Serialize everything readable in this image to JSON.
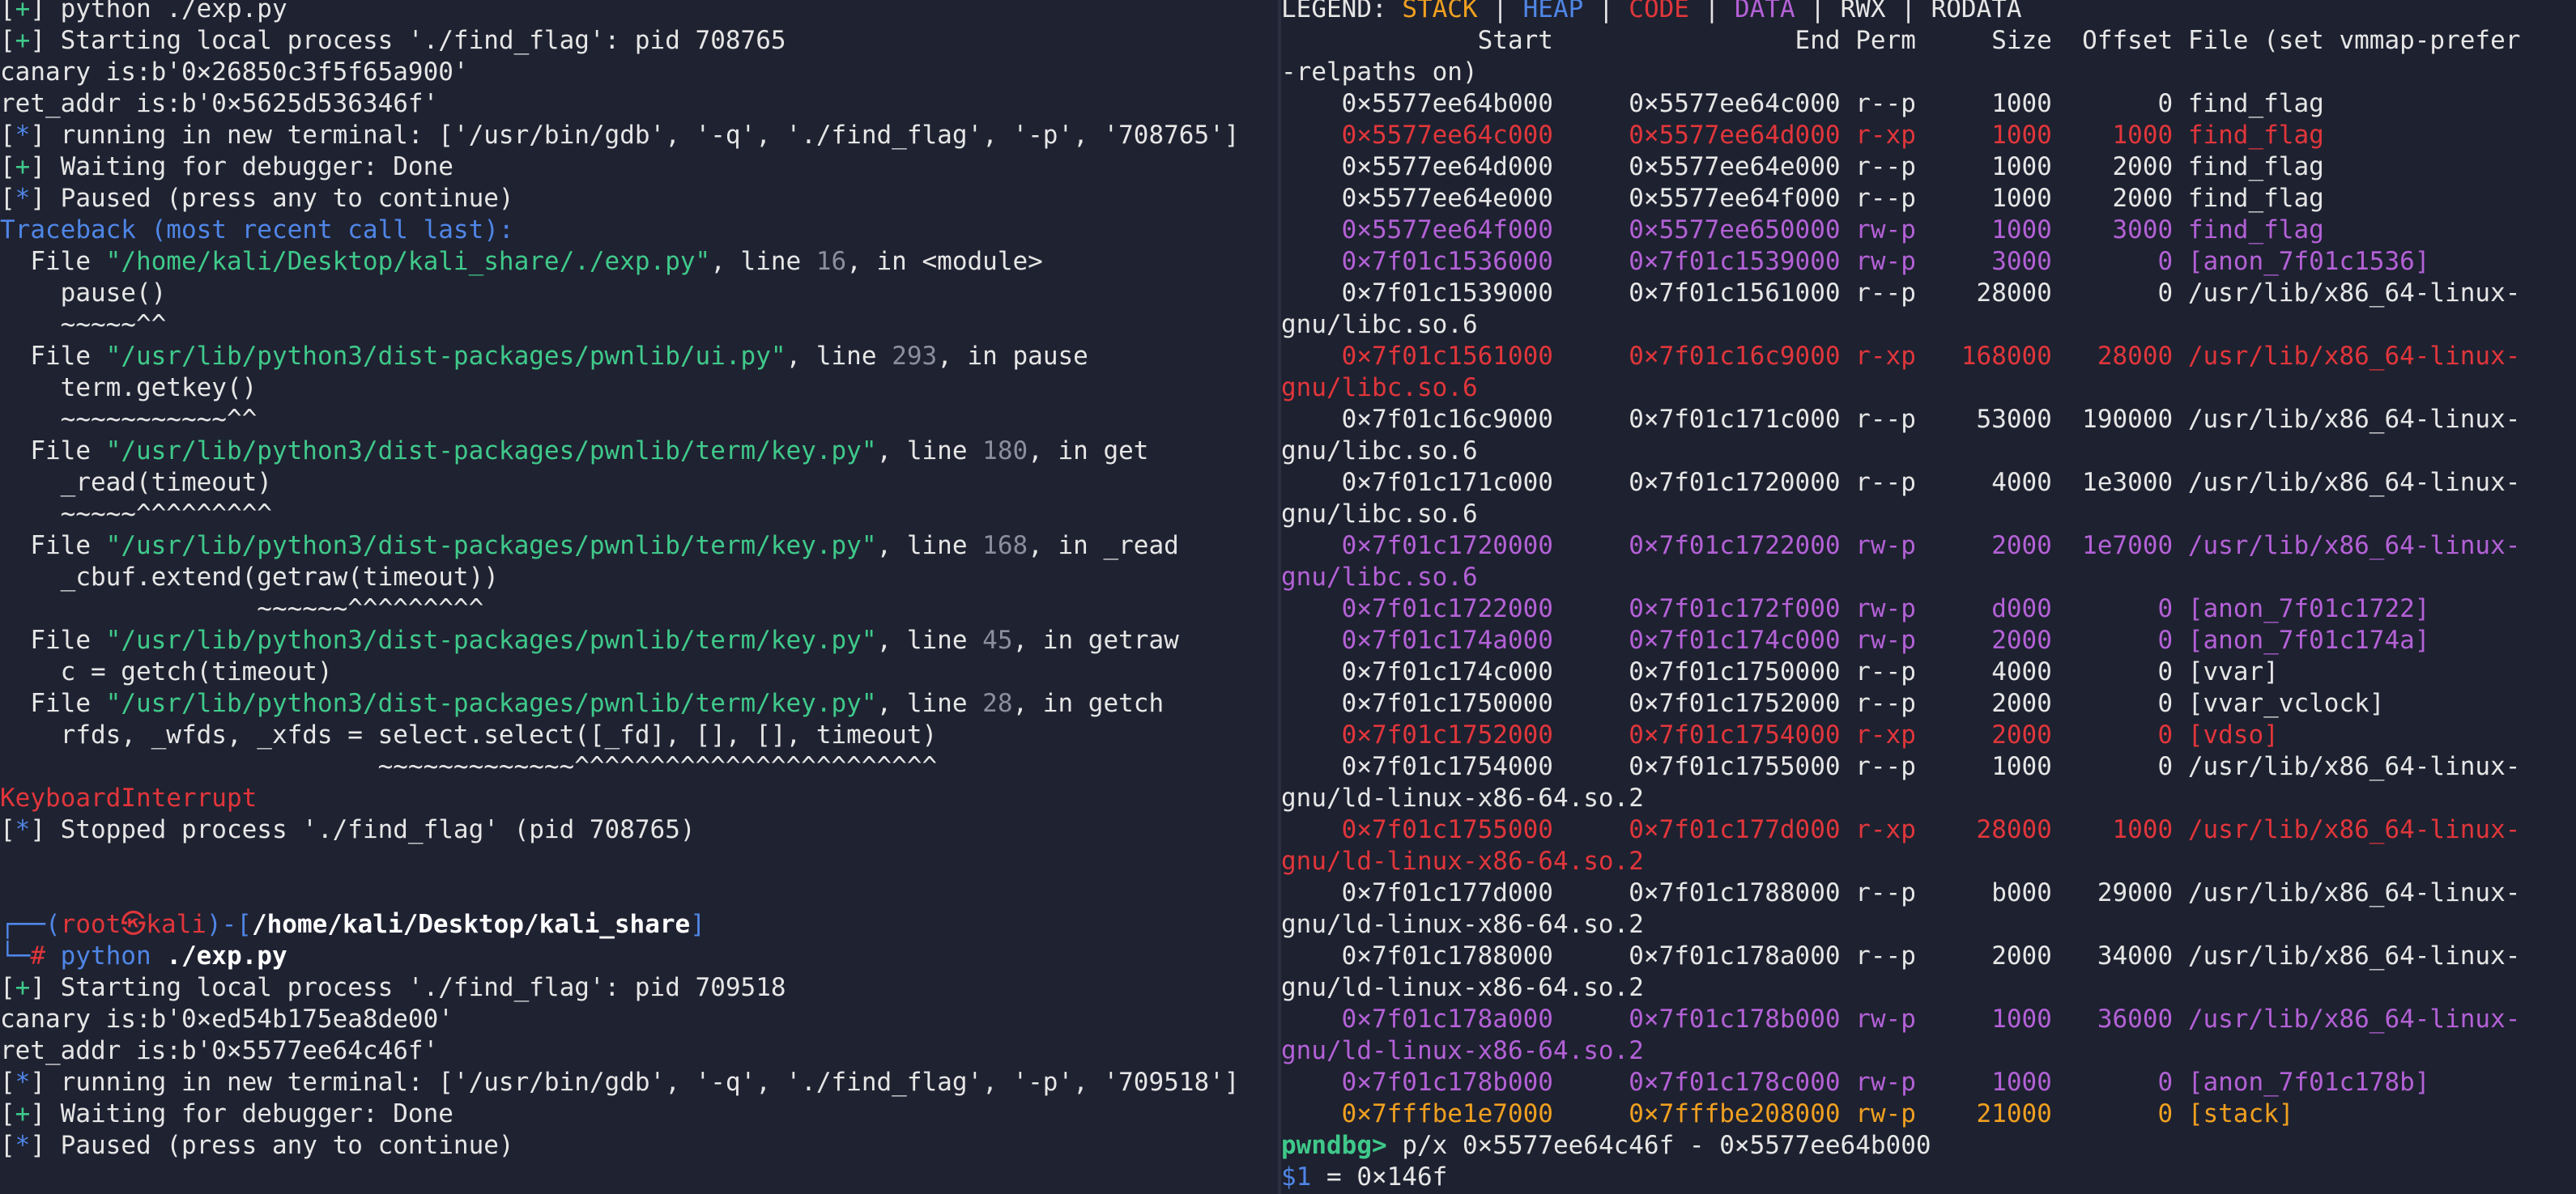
{
  "left_terminal": {
    "lines": [
      [
        {
          "t": "[",
          "c": "default"
        },
        {
          "t": "+",
          "c": "green"
        },
        {
          "t": "] python ./exp.py",
          "c": "default"
        }
      ],
      [
        {
          "t": "[",
          "c": "default"
        },
        {
          "t": "+",
          "c": "green"
        },
        {
          "t": "] Starting local process './find_flag': pid 708765",
          "c": "default"
        }
      ],
      [
        {
          "t": "canary is:b'0×26850c3f5f65a900'",
          "c": "default"
        }
      ],
      [
        {
          "t": "ret_addr is:b'0×5625d536346f'",
          "c": "default"
        }
      ],
      [
        {
          "t": "[",
          "c": "default"
        },
        {
          "t": "*",
          "c": "blue"
        },
        {
          "t": "] running in new terminal: ['/usr/bin/gdb', '-q', './find_flag', '-p', '708765']",
          "c": "default"
        }
      ],
      [
        {
          "t": "[",
          "c": "default"
        },
        {
          "t": "+",
          "c": "green"
        },
        {
          "t": "] Waiting for debugger: Done",
          "c": "default"
        }
      ],
      [
        {
          "t": "[",
          "c": "default"
        },
        {
          "t": "*",
          "c": "blue"
        },
        {
          "t": "] Paused (press any to continue)",
          "c": "default"
        }
      ],
      [
        {
          "t": "Traceback (most recent call last):",
          "c": "blue"
        }
      ],
      [
        {
          "t": "  File ",
          "c": "default"
        },
        {
          "t": "\"/home/kali/Desktop/kali_share/./exp.py\"",
          "c": "green"
        },
        {
          "t": ", line ",
          "c": "default"
        },
        {
          "t": "16",
          "c": "gray"
        },
        {
          "t": ", in <module>",
          "c": "default"
        }
      ],
      [
        {
          "t": "    pause()",
          "c": "default"
        }
      ],
      [
        {
          "t": "    ~~~~~^^",
          "c": "default"
        }
      ],
      [
        {
          "t": "  File ",
          "c": "default"
        },
        {
          "t": "\"/usr/lib/python3/dist-packages/pwnlib/ui.py\"",
          "c": "green"
        },
        {
          "t": ", line ",
          "c": "default"
        },
        {
          "t": "293",
          "c": "gray"
        },
        {
          "t": ", in pause",
          "c": "default"
        }
      ],
      [
        {
          "t": "    term.getkey()",
          "c": "default"
        }
      ],
      [
        {
          "t": "    ~~~~~~~~~~~^^",
          "c": "default"
        }
      ],
      [
        {
          "t": "  File ",
          "c": "default"
        },
        {
          "t": "\"/usr/lib/python3/dist-packages/pwnlib/term/key.py\"",
          "c": "green"
        },
        {
          "t": ", line ",
          "c": "default"
        },
        {
          "t": "180",
          "c": "gray"
        },
        {
          "t": ", in get",
          "c": "default"
        }
      ],
      [
        {
          "t": "    _read(timeout)",
          "c": "default"
        }
      ],
      [
        {
          "t": "    ~~~~~^^^^^^^^^",
          "c": "default"
        }
      ],
      [
        {
          "t": "  File ",
          "c": "default"
        },
        {
          "t": "\"/usr/lib/python3/dist-packages/pwnlib/term/key.py\"",
          "c": "green"
        },
        {
          "t": ", line ",
          "c": "default"
        },
        {
          "t": "168",
          "c": "gray"
        },
        {
          "t": ", in _read",
          "c": "default"
        }
      ],
      [
        {
          "t": "    _cbuf.extend(getraw(timeout))",
          "c": "default"
        }
      ],
      [
        {
          "t": "                 ~~~~~~^^^^^^^^^",
          "c": "default"
        }
      ],
      [
        {
          "t": "  File ",
          "c": "default"
        },
        {
          "t": "\"/usr/lib/python3/dist-packages/pwnlib/term/key.py\"",
          "c": "green"
        },
        {
          "t": ", line ",
          "c": "default"
        },
        {
          "t": "45",
          "c": "gray"
        },
        {
          "t": ", in getraw",
          "c": "default"
        }
      ],
      [
        {
          "t": "    c = getch(timeout)",
          "c": "default"
        }
      ],
      [
        {
          "t": "  File ",
          "c": "default"
        },
        {
          "t": "\"/usr/lib/python3/dist-packages/pwnlib/term/key.py\"",
          "c": "green"
        },
        {
          "t": ", line ",
          "c": "default"
        },
        {
          "t": "28",
          "c": "gray"
        },
        {
          "t": ", in getch",
          "c": "default"
        }
      ],
      [
        {
          "t": "    rfds, _wfds, _xfds = select.select([_fd], [], [], timeout)",
          "c": "default"
        }
      ],
      [
        {
          "t": "                         ~~~~~~~~~~~~~^^^^^^^^^^^^^^^^^^^^^^^^",
          "c": "default"
        }
      ],
      [
        {
          "t": "KeyboardInterrupt",
          "c": "red"
        }
      ],
      [
        {
          "t": "[",
          "c": "default"
        },
        {
          "t": "*",
          "c": "blue"
        },
        {
          "t": "] Stopped process './find_flag' (pid 708765)",
          "c": "default"
        }
      ],
      [
        {
          "t": "",
          "c": "default"
        }
      ],
      [
        {
          "t": "",
          "c": "default"
        }
      ],
      [
        {
          "t": "┌──(",
          "c": "blue"
        },
        {
          "t": "root㉿kali",
          "c": "red"
        },
        {
          "t": ")-[",
          "c": "blue"
        },
        {
          "t": "/home/kali/Desktop/kali_share",
          "c": "white"
        },
        {
          "t": "]",
          "c": "blue"
        }
      ],
      [
        {
          "t": "└─",
          "c": "blue"
        },
        {
          "t": "# ",
          "c": "red"
        },
        {
          "t": "python ",
          "c": "blue"
        },
        {
          "t": "./exp.py",
          "c": "white"
        }
      ],
      [
        {
          "t": "[",
          "c": "default"
        },
        {
          "t": "+",
          "c": "green"
        },
        {
          "t": "] Starting local process './find_flag': pid 709518",
          "c": "default"
        }
      ],
      [
        {
          "t": "canary is:b'0×ed54b175ea8de00'",
          "c": "default"
        }
      ],
      [
        {
          "t": "ret_addr is:b'0×5577ee64c46f'",
          "c": "default"
        }
      ],
      [
        {
          "t": "[",
          "c": "default"
        },
        {
          "t": "*",
          "c": "blue"
        },
        {
          "t": "] running in new terminal: ['/usr/bin/gdb', '-q', './find_flag', '-p', '709518']",
          "c": "default"
        }
      ],
      [
        {
          "t": "[",
          "c": "default"
        },
        {
          "t": "+",
          "c": "green"
        },
        {
          "t": "] Waiting for debugger: Done",
          "c": "default"
        }
      ],
      [
        {
          "t": "[",
          "c": "default"
        },
        {
          "t": "*",
          "c": "blue"
        },
        {
          "t": "] Paused (press any to continue)",
          "c": "default"
        }
      ]
    ]
  },
  "right_terminal": {
    "lines": [
      [
        {
          "t": "LEGEND: ",
          "c": "default"
        },
        {
          "t": "STACK",
          "c": "orange"
        },
        {
          "t": " | ",
          "c": "default"
        },
        {
          "t": "HEAP",
          "c": "blue"
        },
        {
          "t": " | ",
          "c": "default"
        },
        {
          "t": "CODE",
          "c": "red"
        },
        {
          "t": " | ",
          "c": "default"
        },
        {
          "t": "DATA",
          "c": "purple"
        },
        {
          "t": " | ",
          "c": "default"
        },
        {
          "t": "RWX",
          "c": "default"
        },
        {
          "t": " | RODATA",
          "c": "default"
        }
      ],
      [
        {
          "t": "             Start                End Perm     Size  Offset File (set vmmap-prefer",
          "c": "default"
        }
      ],
      [
        {
          "t": "-relpaths on)",
          "c": "default"
        }
      ],
      [
        {
          "t": "    0×5577ee64b000     0×5577ee64c000 r--p     1000       0 find_flag",
          "c": "default"
        }
      ],
      [
        {
          "t": "    0×5577ee64c000     0×5577ee64d000 r-xp     1000    1000 find_flag",
          "c": "red"
        }
      ],
      [
        {
          "t": "    0×5577ee64d000     0×5577ee64e000 r--p     1000    2000 find_flag",
          "c": "default"
        }
      ],
      [
        {
          "t": "    0×5577ee64e000     0×5577ee64f000 r--p     1000    2000 find_flag",
          "c": "default"
        }
      ],
      [
        {
          "t": "    0×5577ee64f000     0×5577ee650000 rw-p     1000    3000 find_flag",
          "c": "purple"
        }
      ],
      [
        {
          "t": "    0×7f01c1536000     0×7f01c1539000 rw-p     3000       0 [anon_7f01c1536]",
          "c": "purple"
        }
      ],
      [
        {
          "t": "    0×7f01c1539000     0×7f01c1561000 r--p    28000       0 /usr/lib/x86_64-linux-",
          "c": "default"
        }
      ],
      [
        {
          "t": "gnu/libc.so.6",
          "c": "default"
        }
      ],
      [
        {
          "t": "    0×7f01c1561000     0×7f01c16c9000 r-xp   168000   28000 /usr/lib/x86_64-linux-",
          "c": "red"
        }
      ],
      [
        {
          "t": "gnu/libc.so.6",
          "c": "red"
        }
      ],
      [
        {
          "t": "    0×7f01c16c9000     0×7f01c171c000 r--p    53000  190000 /usr/lib/x86_64-linux-",
          "c": "default"
        }
      ],
      [
        {
          "t": "gnu/libc.so.6",
          "c": "default"
        }
      ],
      [
        {
          "t": "    0×7f01c171c000     0×7f01c1720000 r--p     4000  1e3000 /usr/lib/x86_64-linux-",
          "c": "default"
        }
      ],
      [
        {
          "t": "gnu/libc.so.6",
          "c": "default"
        }
      ],
      [
        {
          "t": "    0×7f01c1720000     0×7f01c1722000 rw-p     2000  1e7000 /usr/lib/x86_64-linux-",
          "c": "purple"
        }
      ],
      [
        {
          "t": "gnu/libc.so.6",
          "c": "purple"
        }
      ],
      [
        {
          "t": "    0×7f01c1722000     0×7f01c172f000 rw-p     d000       0 [anon_7f01c1722]",
          "c": "purple"
        }
      ],
      [
        {
          "t": "    0×7f01c174a000     0×7f01c174c000 rw-p     2000       0 [anon_7f01c174a]",
          "c": "purple"
        }
      ],
      [
        {
          "t": "    0×7f01c174c000     0×7f01c1750000 r--p     4000       0 [vvar]",
          "c": "default"
        }
      ],
      [
        {
          "t": "    0×7f01c1750000     0×7f01c1752000 r--p     2000       0 [vvar_vclock]",
          "c": "default"
        }
      ],
      [
        {
          "t": "    0×7f01c1752000     0×7f01c1754000 r-xp     2000       0 [vdso]",
          "c": "red"
        }
      ],
      [
        {
          "t": "    0×7f01c1754000     0×7f01c1755000 r--p     1000       0 /usr/lib/x86_64-linux-",
          "c": "default"
        }
      ],
      [
        {
          "t": "gnu/ld-linux-x86-64.so.2",
          "c": "default"
        }
      ],
      [
        {
          "t": "    0×7f01c1755000     0×7f01c177d000 r-xp    28000    1000 /usr/lib/x86_64-linux-",
          "c": "red"
        }
      ],
      [
        {
          "t": "gnu/ld-linux-x86-64.so.2",
          "c": "red"
        }
      ],
      [
        {
          "t": "    0×7f01c177d000     0×7f01c1788000 r--p     b000   29000 /usr/lib/x86_64-linux-",
          "c": "default"
        }
      ],
      [
        {
          "t": "gnu/ld-linux-x86-64.so.2",
          "c": "default"
        }
      ],
      [
        {
          "t": "    0×7f01c1788000     0×7f01c178a000 r--p     2000   34000 /usr/lib/x86_64-linux-",
          "c": "default"
        }
      ],
      [
        {
          "t": "gnu/ld-linux-x86-64.so.2",
          "c": "default"
        }
      ],
      [
        {
          "t": "    0×7f01c178a000     0×7f01c178b000 rw-p     1000   36000 /usr/lib/x86_64-linux-",
          "c": "purple"
        }
      ],
      [
        {
          "t": "gnu/ld-linux-x86-64.so.2",
          "c": "purple"
        }
      ],
      [
        {
          "t": "    0×7f01c178b000     0×7f01c178c000 rw-p     1000       0 [anon_7f01c178b]",
          "c": "purple"
        }
      ],
      [
        {
          "t": "    0×7fffbe1e7000     0×7fffbe208000 rw-p    21000       0 [stack]",
          "c": "orange"
        }
      ],
      [
        {
          "t": "pwndbg> ",
          "c": "prompt"
        },
        {
          "t": "p/x 0×5577ee64c46f - 0×5577ee64b000",
          "c": "default"
        }
      ],
      [
        {
          "t": "$1",
          "c": "blue"
        },
        {
          "t": " = 0×146f",
          "c": "default"
        }
      ],
      [
        {
          "t": "pwndbg> ",
          "c": "prompt"
        }
      ]
    ]
  }
}
